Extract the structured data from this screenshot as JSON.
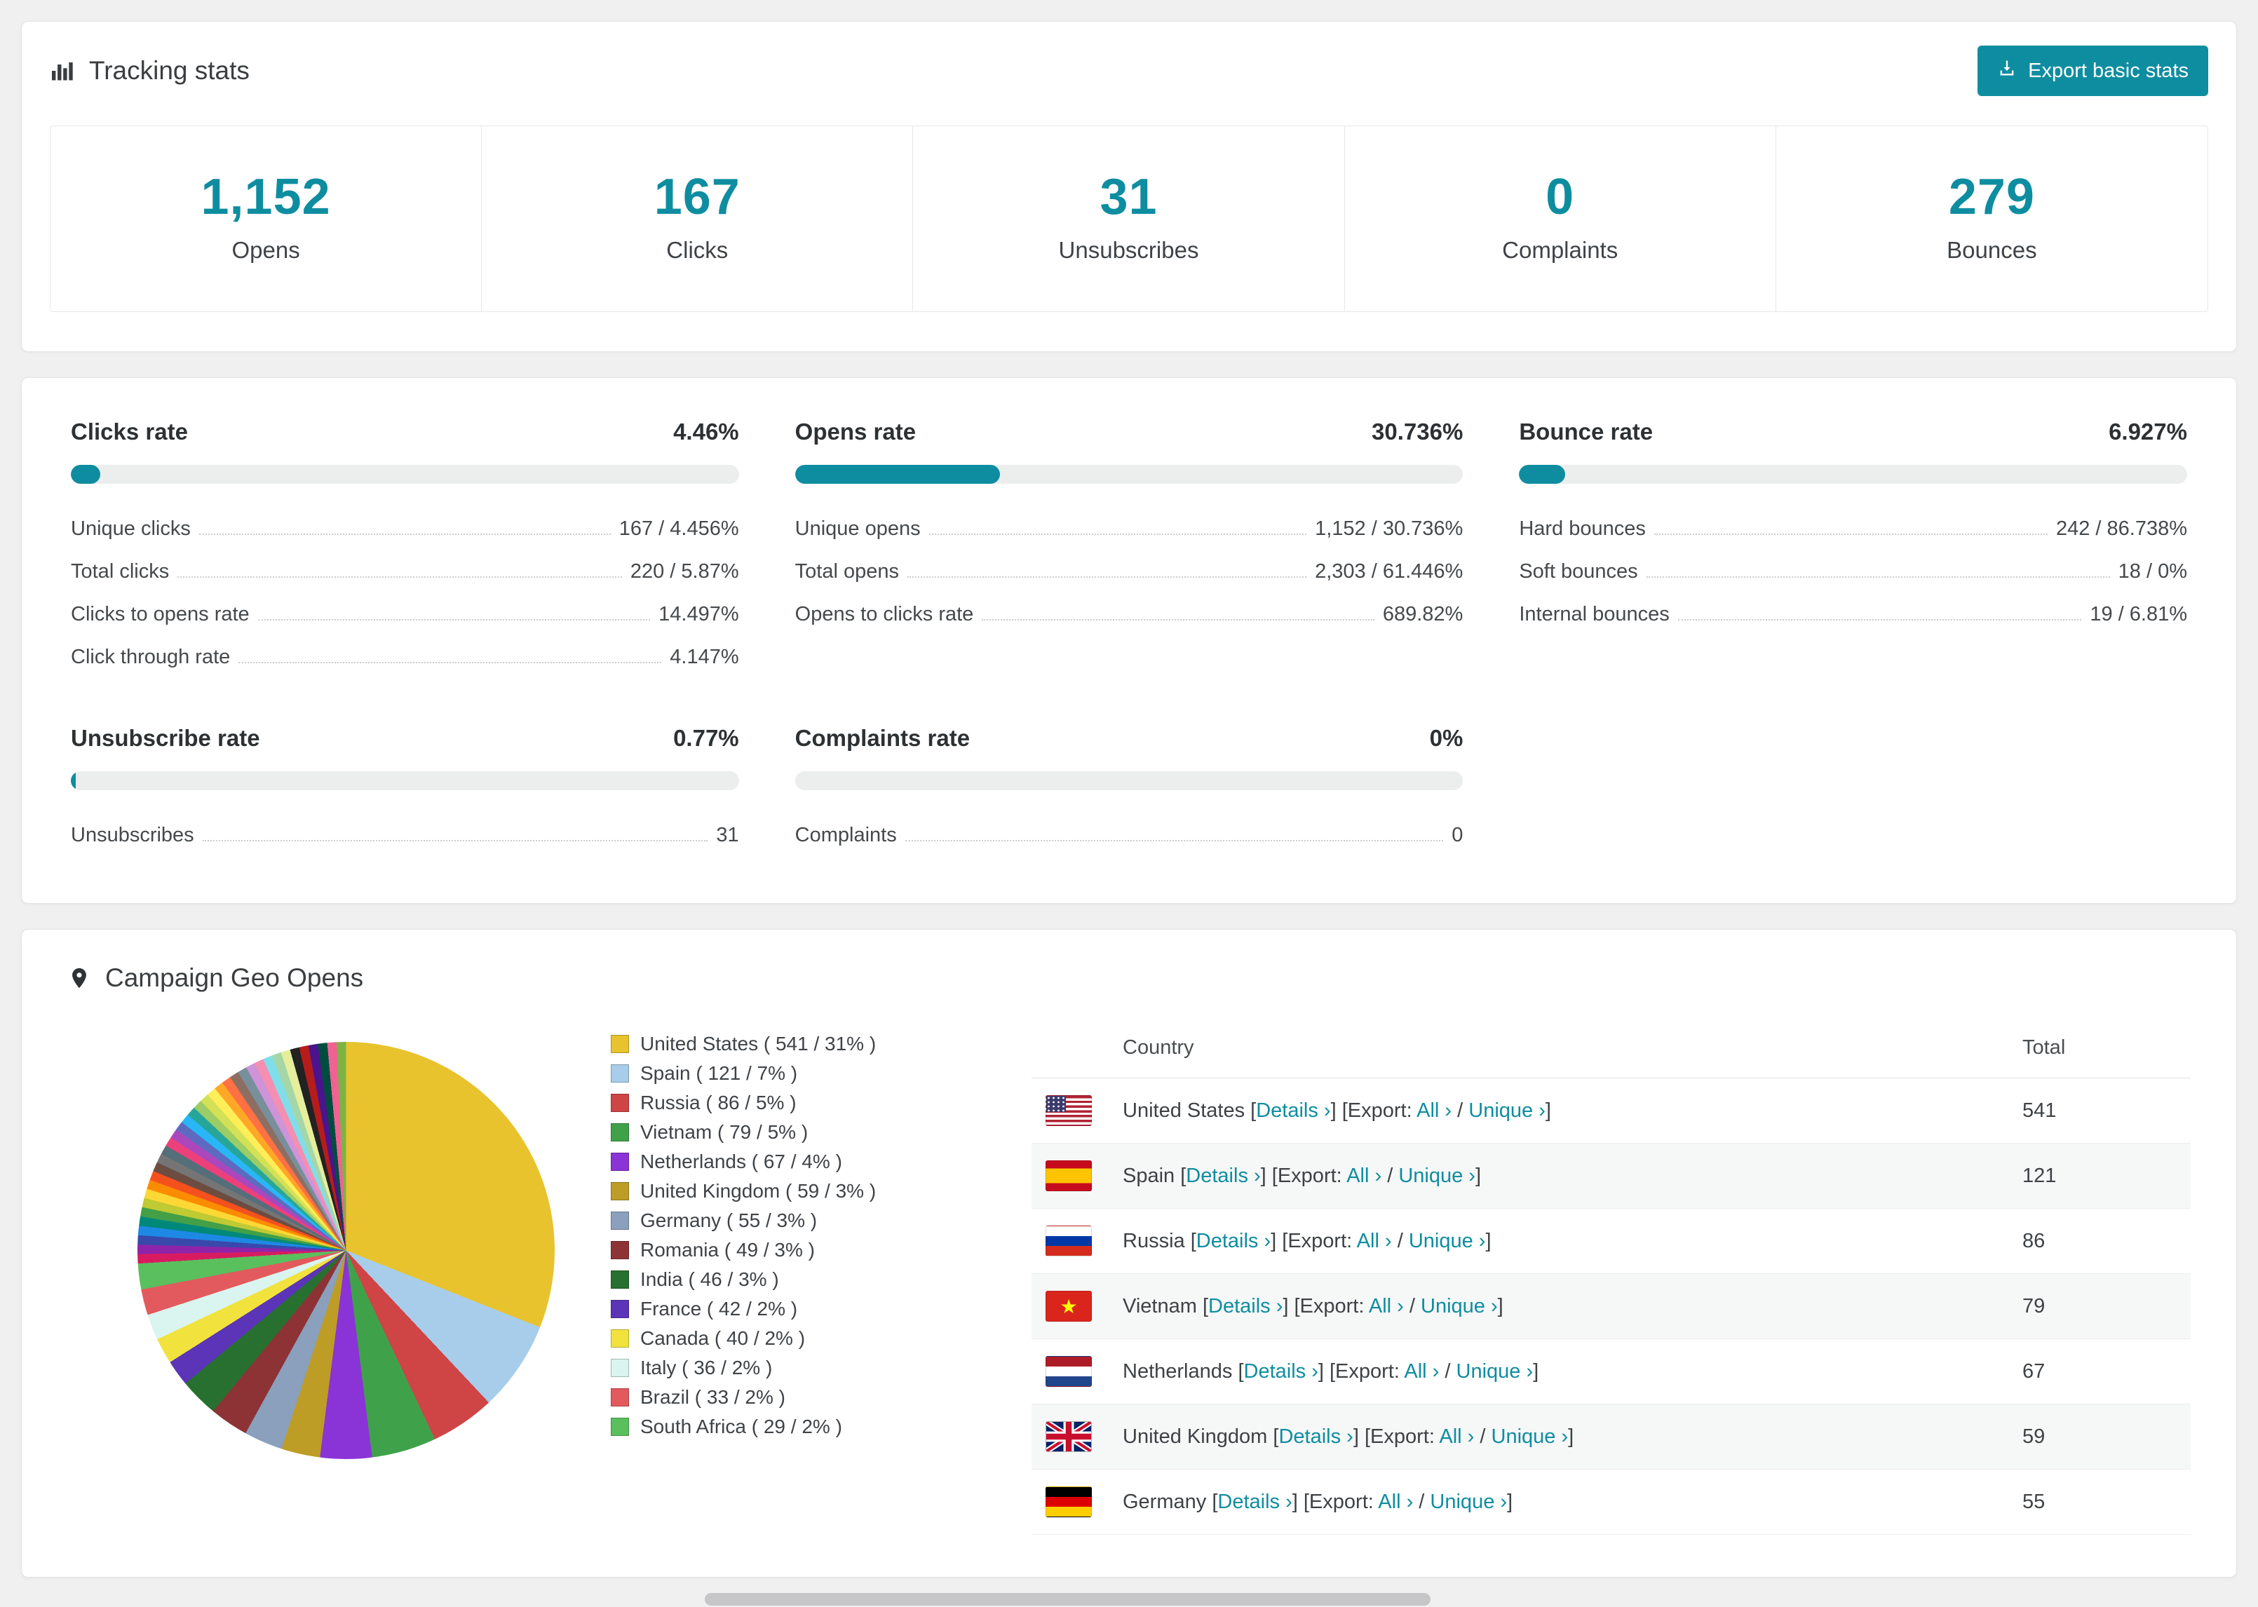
{
  "colors": {
    "accent": "#0e8da0",
    "heading": "#3b3e40"
  },
  "icons": {
    "tracking": "bar-chart-icon",
    "export": "export-icon",
    "geo": "map-pin-icon"
  },
  "tracking": {
    "title": "Tracking stats",
    "export_button": "Export basic stats",
    "stats": [
      {
        "value": "1,152",
        "label": "Opens"
      },
      {
        "value": "167",
        "label": "Clicks"
      },
      {
        "value": "31",
        "label": "Unsubscribes"
      },
      {
        "value": "0",
        "label": "Complaints"
      },
      {
        "value": "279",
        "label": "Bounces"
      }
    ]
  },
  "rates": [
    {
      "title": "Clicks rate",
      "value": "4.46%",
      "percent": 4.46,
      "rows": [
        {
          "label": "Unique clicks",
          "value": "167 / 4.456%"
        },
        {
          "label": "Total clicks",
          "value": "220 / 5.87%"
        },
        {
          "label": "Clicks to opens rate",
          "value": "14.497%"
        },
        {
          "label": "Click through rate",
          "value": "4.147%"
        }
      ]
    },
    {
      "title": "Opens rate",
      "value": "30.736%",
      "percent": 30.736,
      "rows": [
        {
          "label": "Unique opens",
          "value": "1,152 / 30.736%"
        },
        {
          "label": "Total opens",
          "value": "2,303 / 61.446%"
        },
        {
          "label": "Opens to clicks rate",
          "value": "689.82%"
        }
      ]
    },
    {
      "title": "Bounce rate",
      "value": "6.927%",
      "percent": 6.927,
      "rows": [
        {
          "label": "Hard bounces",
          "value": "242 / 86.738%"
        },
        {
          "label": "Soft bounces",
          "value": "18 / 0%"
        },
        {
          "label": "Internal bounces",
          "value": "19 / 6.81%"
        }
      ]
    },
    {
      "title": "Unsubscribe rate",
      "value": "0.77%",
      "percent": 0.77,
      "rows": [
        {
          "label": "Unsubscribes",
          "value": "31"
        }
      ]
    },
    {
      "title": "Complaints rate",
      "value": "0%",
      "percent": 0,
      "rows": [
        {
          "label": "Complaints",
          "value": "0"
        }
      ]
    }
  ],
  "geo": {
    "title": "Campaign Geo Opens",
    "chart_data": {
      "type": "pie",
      "title": "Campaign Geo Opens",
      "legend_position": "right",
      "items": [
        {
          "name": "United States",
          "opens": 541,
          "pct": 31,
          "color": "#e8c32e",
          "label": "United States ( 541 / 31% )"
        },
        {
          "name": "Spain",
          "opens": 121,
          "pct": 7,
          "color": "#a7cdea",
          "label": "Spain ( 121 / 7% )"
        },
        {
          "name": "Russia",
          "opens": 86,
          "pct": 5,
          "color": "#cf4445",
          "label": "Russia ( 86 / 5% )"
        },
        {
          "name": "Vietnam",
          "opens": 79,
          "pct": 5,
          "color": "#3fa24a",
          "label": "Vietnam ( 79 / 5% )"
        },
        {
          "name": "Netherlands",
          "opens": 67,
          "pct": 4,
          "color": "#8a33d6",
          "label": "Netherlands ( 67 / 4% )"
        },
        {
          "name": "United Kingdom",
          "opens": 59,
          "pct": 3,
          "color": "#bd9d26",
          "label": "United Kingdom ( 59 / 3% )"
        },
        {
          "name": "Germany",
          "opens": 55,
          "pct": 3,
          "color": "#8aa0bc",
          "label": "Germany ( 55 / 3% )"
        },
        {
          "name": "Romania",
          "opens": 49,
          "pct": 3,
          "color": "#8e3335",
          "label": "Romania ( 49 / 3% )"
        },
        {
          "name": "India",
          "opens": 46,
          "pct": 3,
          "color": "#27702f",
          "label": "India ( 46 / 3% )"
        },
        {
          "name": "France",
          "opens": 42,
          "pct": 2,
          "color": "#5b34b8",
          "label": "France ( 42 / 2% )"
        },
        {
          "name": "Canada",
          "opens": 40,
          "pct": 2,
          "color": "#f2e23d",
          "label": "Canada ( 40 / 2% )"
        },
        {
          "name": "Italy",
          "opens": 36,
          "pct": 2,
          "color": "#daf4ef",
          "label": "Italy ( 36 / 2% )"
        },
        {
          "name": "Brazil",
          "opens": 33,
          "pct": 2,
          "color": "#e35a5e",
          "label": "Brazil ( 33 / 2% )"
        },
        {
          "name": "South Africa",
          "opens": 29,
          "pct": 2,
          "color": "#5abf5d",
          "label": "South Africa ( 29 / 2% )"
        }
      ],
      "others_colors": [
        "#d81b60",
        "#8e24aa",
        "#3949ab",
        "#1e88e5",
        "#00897b",
        "#43a047",
        "#c0ca33",
        "#fdd835",
        "#fb8c00",
        "#f4511e",
        "#6d4c41",
        "#757575",
        "#546e7a",
        "#ec407a",
        "#ab47bc",
        "#5c6bc0",
        "#29b6f6",
        "#26a69a",
        "#9ccc65",
        "#d4e157",
        "#ffee58",
        "#ffa726",
        "#ff7043",
        "#8d6e63",
        "#78909c",
        "#ce93d8",
        "#f48fb1",
        "#80deea",
        "#a5d6a7",
        "#e6ee9c",
        "#222222",
        "#b71c1c",
        "#4a148c",
        "#004d40",
        "#f06292",
        "#7cb342"
      ]
    },
    "table": {
      "headers": {
        "country": "Country",
        "total": "Total"
      },
      "details_label": "Details ›",
      "export_label": "[Export:",
      "open_bracket": "[",
      "close_bracket": "]",
      "slash": "/",
      "all_label": "All ›",
      "unique_label": "Unique ›",
      "rows": [
        {
          "country": "United States",
          "total": "541",
          "flag": "us"
        },
        {
          "country": "Spain",
          "total": "121",
          "flag": "es"
        },
        {
          "country": "Russia",
          "total": "86",
          "flag": "ru"
        },
        {
          "country": "Vietnam",
          "total": "79",
          "flag": "vn"
        },
        {
          "country": "Netherlands",
          "total": "67",
          "flag": "nl"
        },
        {
          "country": "United Kingdom",
          "total": "59",
          "flag": "gb"
        },
        {
          "country": "Germany",
          "total": "55",
          "flag": "de"
        }
      ]
    }
  }
}
